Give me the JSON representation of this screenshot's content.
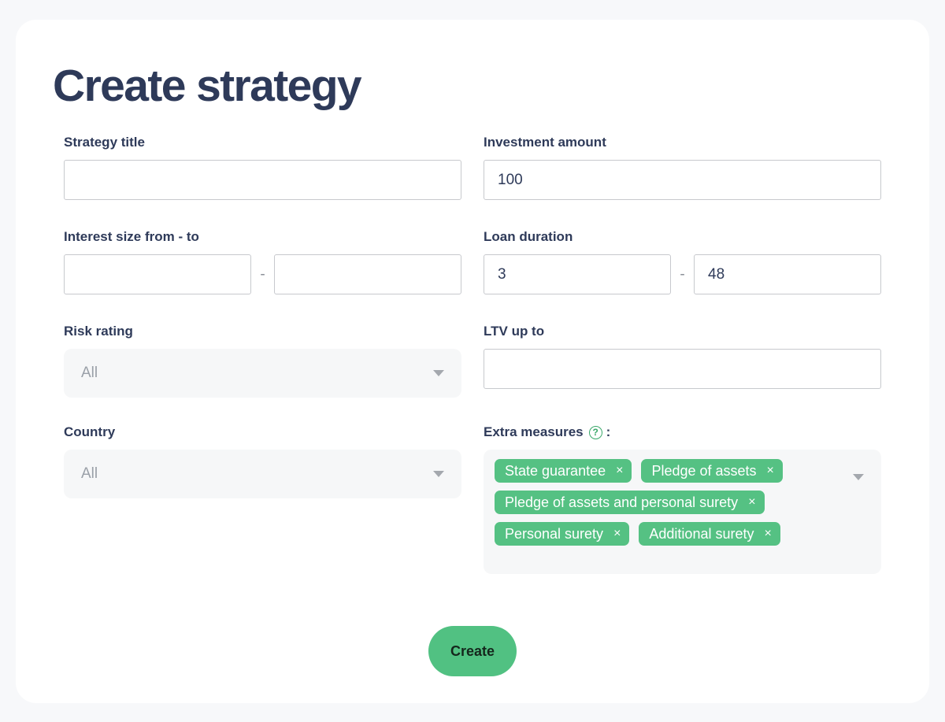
{
  "page": {
    "title": "Create strategy"
  },
  "fields": {
    "strategy_title": {
      "label": "Strategy title",
      "value": "",
      "placeholder": ""
    },
    "investment_amount": {
      "label": "Investment amount",
      "value": "100",
      "placeholder": ""
    },
    "interest_size": {
      "label": "Interest size from - to",
      "separator": "-",
      "from_value": "",
      "to_value": "",
      "from_placeholder": "",
      "to_placeholder": ""
    },
    "loan_duration": {
      "label": "Loan duration",
      "separator": "-",
      "from_value": "3",
      "to_value": "48",
      "from_placeholder": "",
      "to_placeholder": ""
    },
    "risk_rating": {
      "label": "Risk rating",
      "value": "All"
    },
    "ltv_up_to": {
      "label": "LTV up to",
      "value": "",
      "placeholder": ""
    },
    "country": {
      "label": "Country",
      "value": "All"
    },
    "extra_measures": {
      "label": "Extra measures",
      "help_icon": "question-mark-icon",
      "help_glyph": "?",
      "colon": ":",
      "tags": [
        {
          "label": "State guarantee",
          "remove": "×"
        },
        {
          "label": "Pledge of assets",
          "remove": "×"
        },
        {
          "label": "Pledge of assets and personal surety",
          "remove": "×"
        },
        {
          "label": "Personal surety",
          "remove": "×"
        },
        {
          "label": "Additional surety",
          "remove": "×"
        }
      ]
    }
  },
  "actions": {
    "create_label": "Create"
  },
  "colors": {
    "accent_green": "#51c182",
    "tag_green": "#55c183",
    "title_navy": "#2e3a59",
    "page_background": "#f7f8fa",
    "field_background": "#f6f7f8"
  }
}
